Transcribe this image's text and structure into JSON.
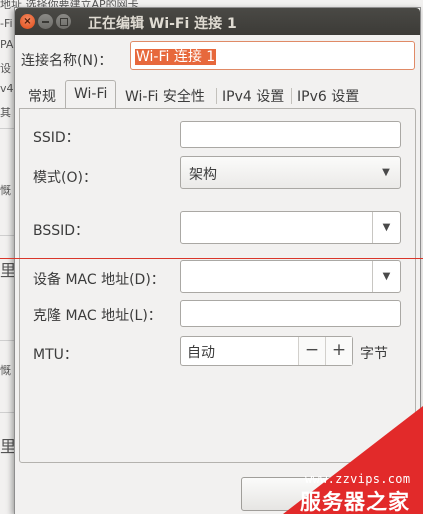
{
  "background": {
    "lines": [
      "地址 选择你要建立AP的网卡",
      "-Fi",
      "PA",
      "设",
      "v4",
      "其",
      "慨",
      "里",
      "慨",
      "里"
    ]
  },
  "window": {
    "title": "正在编辑 Wi-Fi 连接 1",
    "close_glyph": "×"
  },
  "connection_name": {
    "label": "连接名称(N)：",
    "value": "Wi-Fi 连接 1"
  },
  "tabs": [
    {
      "label": "常规",
      "active": false
    },
    {
      "label": "Wi-Fi",
      "active": true
    },
    {
      "label": "Wi-Fi 安全性",
      "active": false
    },
    {
      "label": "IPv4 设置",
      "active": false
    },
    {
      "label": "IPv6 设置",
      "active": false
    }
  ],
  "wifi": {
    "ssid": {
      "label": "SSID：",
      "value": ""
    },
    "mode": {
      "label": "模式(O)：",
      "value": "架构"
    },
    "bssid": {
      "label": "BSSID：",
      "value": ""
    },
    "device_mac": {
      "label": "设备 MAC 地址(D)：",
      "value": ""
    },
    "cloned_mac": {
      "label": "克隆 MAC 地址(L)：",
      "value": ""
    },
    "mtu": {
      "label": "MTU：",
      "value": "自动",
      "minus": "−",
      "plus": "+",
      "unit": "字节"
    }
  },
  "icons": {
    "dropdown": "▼"
  },
  "watermark": {
    "url": "www.zzvips.com",
    "brand": "服务器之家"
  },
  "colors": {
    "accent": "#e7683c",
    "titlebar": "#3c3b37",
    "watermark": "#e22a2a"
  }
}
